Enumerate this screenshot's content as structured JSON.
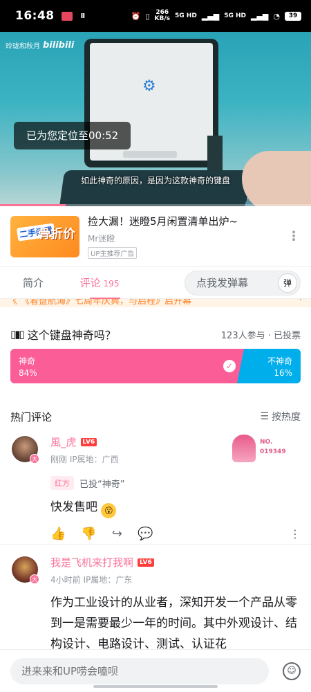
{
  "status_bar": {
    "time": "16:48",
    "notif_badge": "CSDN",
    "pause": "II",
    "speed_value": "266",
    "speed_unit": "KB/s",
    "sig1": "5G HD",
    "sig2": "5G HD",
    "battery": "39"
  },
  "video": {
    "watermark_channel": "玲珑和秋月",
    "watermark_logo": "bilibili",
    "toast": "已为您定位至00:52",
    "subtitle": "如此神奇的原因，是因为这款神奇的键盘",
    "progress_fraction": 0.21
  },
  "ad": {
    "thumb_tag": "二手闲置",
    "thumb_title": "骨折价",
    "title": "捡大漏！迷瞪5月闲置清单出炉~",
    "uploader": "Mr迷瞪",
    "label": "UP主推荐广告"
  },
  "tabs": {
    "intro": "简介",
    "comments": "评论",
    "comments_count": "195",
    "danmu_placeholder": "点我发弹幕",
    "danmu_button": "弹"
  },
  "notice": {
    "text": "《着盘航海》七周年庆典，与启程》启开幕"
  },
  "vote": {
    "question": "这个键盘神奇吗？",
    "meta": "123人参与 · 已投票",
    "yes_label": "神奇",
    "yes_pct": "84%",
    "no_label": "不神奇",
    "no_pct": "16%"
  },
  "hot": {
    "title": "热门评论",
    "sort_label": "按热度"
  },
  "comments": [
    {
      "username": "風_虎",
      "level": "LV6",
      "time": "刚刚",
      "ip": "IP属地：广西",
      "vote_pill": "红方",
      "vote_text": "已投“神奇”",
      "text": "快发售吧",
      "fan_no_label": "NO.",
      "fan_no_number": "019349",
      "avatar_badge": "大"
    },
    {
      "username": "我是飞机来打我啊",
      "level": "LV6",
      "time": "4小时前",
      "ip": "IP属地：广东",
      "text": "作为工业设计的从业者，深知开发一个产品从零到一是需要最少一年的时间。其中外观设计、结构设计、电路设计、测试、认证花",
      "avatar_badge": "大"
    }
  ],
  "bottom": {
    "input_placeholder": "进来来和UP唠会嗑呗"
  }
}
